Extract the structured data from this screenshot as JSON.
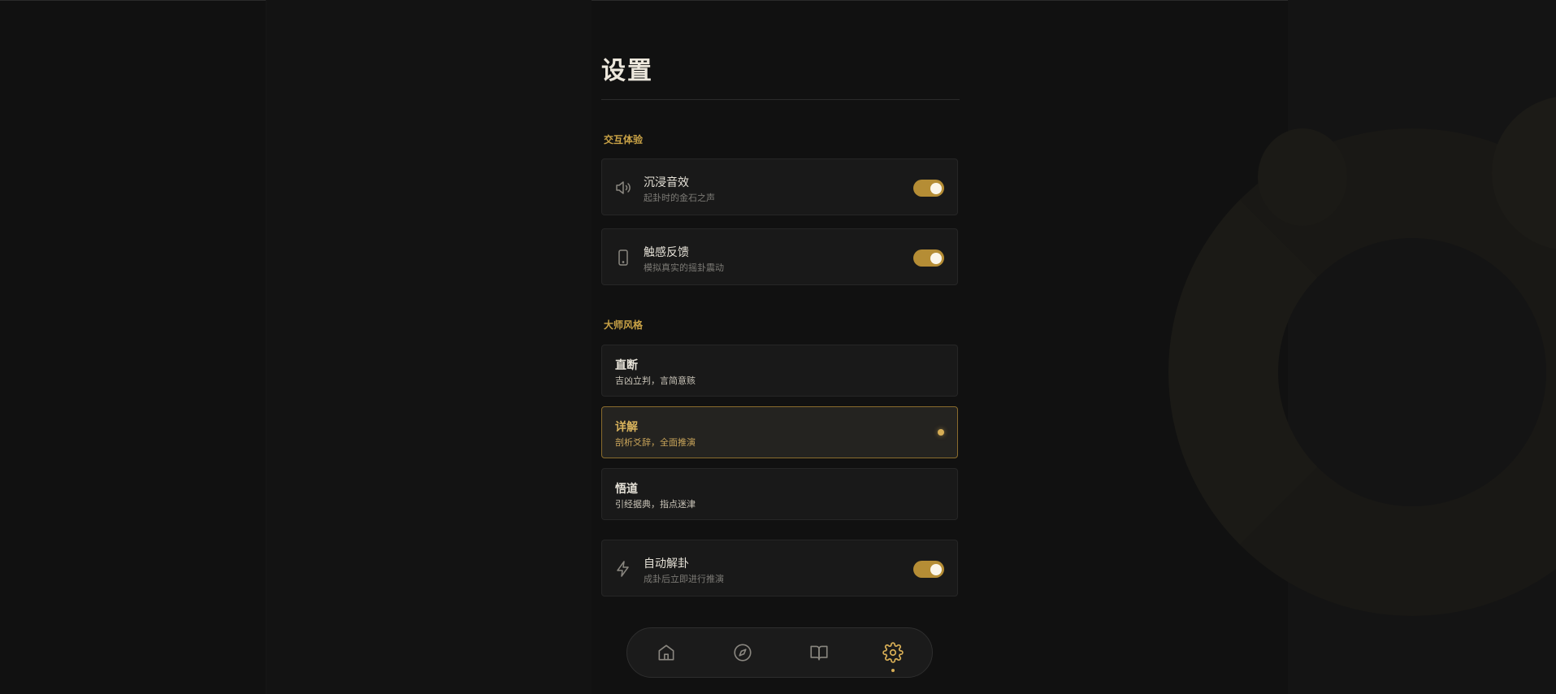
{
  "page": {
    "title": "设置"
  },
  "sections": {
    "interaction": {
      "label": "交互体验",
      "sound": {
        "title": "沉浸音效",
        "subtitle": "起卦时的金石之声",
        "enabled": true,
        "icon": "speaker-icon"
      },
      "haptic": {
        "title": "触感反馈",
        "subtitle": "模拟真实的摇卦震动",
        "enabled": true,
        "icon": "phone-icon"
      }
    },
    "master_style": {
      "label": "大师风格",
      "options": [
        {
          "title": "直断",
          "subtitle": "吉凶立判，言简意赅",
          "selected": false
        },
        {
          "title": "详解",
          "subtitle": "剖析爻辞，全面推演",
          "selected": true
        },
        {
          "title": "悟道",
          "subtitle": "引经据典，指点迷津",
          "selected": false
        }
      ]
    },
    "auto": {
      "title": "自动解卦",
      "subtitle": "成卦后立即进行推演",
      "enabled": true,
      "icon": "lightning-icon"
    }
  },
  "nav": {
    "items": [
      {
        "icon": "home-icon",
        "active": false
      },
      {
        "icon": "compass-icon",
        "active": false
      },
      {
        "icon": "book-icon",
        "active": false
      },
      {
        "icon": "gear-icon",
        "active": true
      }
    ]
  },
  "colors": {
    "accent": "#c9a246",
    "background": "#111111",
    "card": "#191919"
  }
}
